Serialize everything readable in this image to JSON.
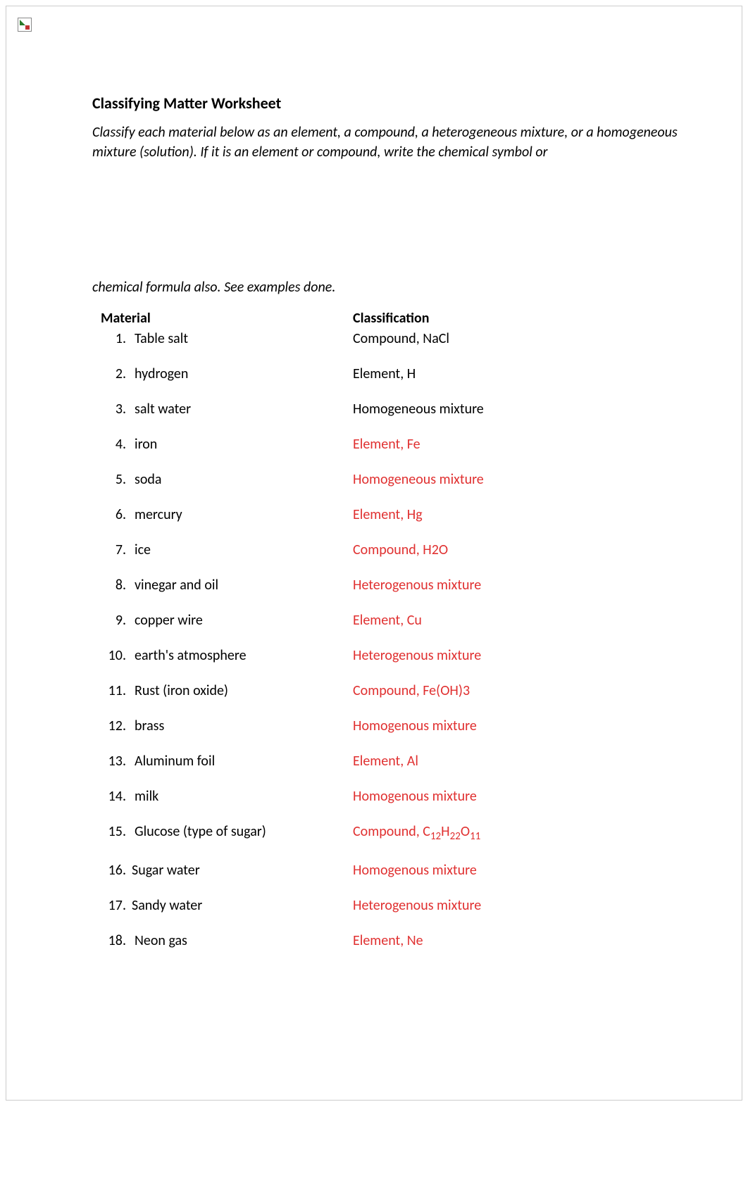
{
  "title": "Classifying Matter Worksheet",
  "instructions_part1": "Classify each material below as an element, a compound, a heterogeneous mixture, or a homogeneous mixture (solution). If it is an element or compound, write the chemical symbol or",
  "instructions_part2": "chemical formula also. See examples done.",
  "headers": {
    "material": "Material",
    "classification": "Classification"
  },
  "rows": [
    {
      "n": "1.",
      "material": "Table salt",
      "classification": "Compound,  NaCl",
      "red": false
    },
    {
      "n": "2.",
      "material": "hydrogen",
      "classification": "Element,  H",
      "red": false
    },
    {
      "n": "3.",
      "material": "salt water",
      "classification": "Homogeneous mixture",
      "red": false
    },
    {
      "n": "4.",
      "material": "iron",
      "classification": "Element, Fe",
      "red": true
    },
    {
      "n": "5.",
      "material": "soda",
      "classification": "Homogeneous mixture",
      "red": true
    },
    {
      "n": "6.",
      "material": "mercury",
      "classification": "Element, Hg",
      "red": true
    },
    {
      "n": "7.",
      "material": "ice",
      "classification": "Compound, H2O",
      "red": true
    },
    {
      "n": "8.",
      "material": "vinegar and oil",
      "classification": "Heterogenous mixture",
      "red": true
    },
    {
      "n": "9.",
      "material": "copper wire",
      "classification": "Element, Cu",
      "red": true
    },
    {
      "n": "10.",
      "material": "earth's atmosphere",
      "classification": "Heterogenous mixture",
      "red": true
    },
    {
      "n": "11.",
      "material": "Rust (iron oxide)",
      "classification": "Compound, Fe(OH)3",
      "red": true
    },
    {
      "n": "12.",
      "material": "brass",
      "classification": "Homogenous mixture",
      "red": true
    },
    {
      "n": "13.",
      "material": "Aluminum foil",
      "classification": "Element, Al",
      "red": true
    },
    {
      "n": "14.",
      "material": "milk",
      "classification": "Homogenous mixture",
      "red": true
    },
    {
      "n": "15.",
      "material": "Glucose (type of sugar)",
      "classification": "Compound, ",
      "formula_html": "C<sub>12</sub>H<sub>22</sub>O<sub>11</sub>",
      "red": true
    },
    {
      "n": "16.",
      "material": "Sugar water",
      "classification": "Homogenous mixture",
      "red": true,
      "flush": true
    },
    {
      "n": "17.",
      "material": "Sandy water",
      "classification": "Heterogenous mixture",
      "red": true,
      "flush": true
    },
    {
      "n": "18.",
      "material": "Neon gas",
      "classification": "Element, Ne",
      "red": true
    }
  ]
}
